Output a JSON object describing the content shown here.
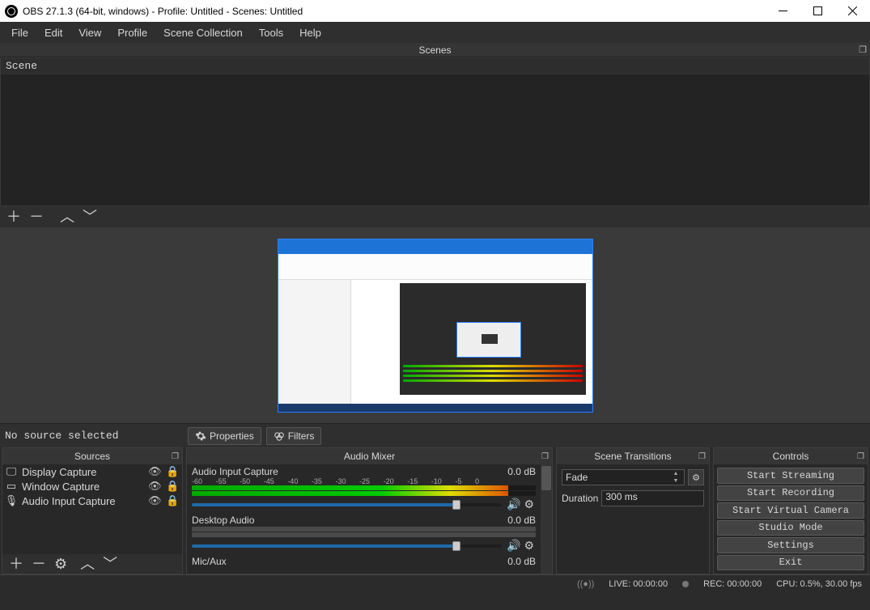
{
  "window": {
    "title": "OBS 27.1.3 (64-bit, windows) - Profile: Untitled - Scenes: Untitled"
  },
  "menu": {
    "items": [
      "File",
      "Edit",
      "View",
      "Profile",
      "Scene Collection",
      "Tools",
      "Help"
    ]
  },
  "scenes": {
    "header": "Scenes",
    "items": [
      "Scene"
    ]
  },
  "preview_toolbar": {
    "message": "No source selected",
    "properties_label": "Properties",
    "filters_label": "Filters"
  },
  "sources": {
    "header": "Sources",
    "items": [
      {
        "name": "Display Capture",
        "icon": "monitor"
      },
      {
        "name": "Window Capture",
        "icon": "window"
      },
      {
        "name": "Audio Input Capture",
        "icon": "mic"
      }
    ]
  },
  "mixer": {
    "header": "Audio Mixer",
    "ticks": [
      "-60",
      "-55",
      "-50",
      "-45",
      "-40",
      "-35",
      "-30",
      "-25",
      "-20",
      "-15",
      "-10",
      "-5",
      "0"
    ],
    "channels": [
      {
        "name": "Audio Input Capture",
        "db": "0.0 dB"
      },
      {
        "name": "Desktop Audio",
        "db": "0.0 dB"
      },
      {
        "name": "Mic/Aux",
        "db": "0.0 dB"
      }
    ]
  },
  "transitions": {
    "header": "Scene Transitions",
    "selected": "Fade",
    "duration_label": "Duration",
    "duration_value": "300 ms"
  },
  "controls": {
    "header": "Controls",
    "buttons": [
      "Start Streaming",
      "Start Recording",
      "Start Virtual Camera",
      "Studio Mode",
      "Settings",
      "Exit"
    ]
  },
  "statusbar": {
    "live": "LIVE: 00:00:00",
    "rec": "REC: 00:00:00",
    "cpu": "CPU: 0.5%, 30.00 fps"
  }
}
